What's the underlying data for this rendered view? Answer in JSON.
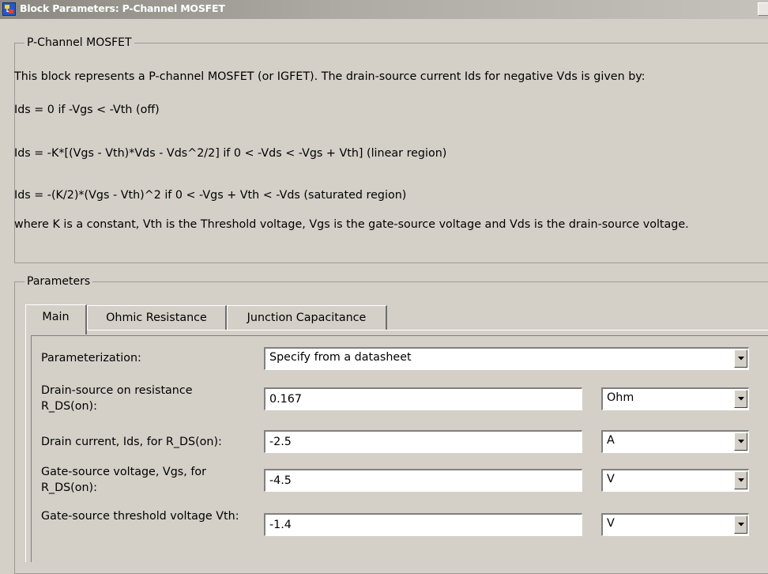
{
  "window": {
    "title": "Block Parameters: P-Channel MOSFET"
  },
  "description": {
    "legend": "P-Channel MOSFET",
    "lines": [
      "This block represents a P-channel MOSFET (or IGFET). The drain-source current Ids for negative Vds is given by:",
      "Ids = 0 if -Vgs < -Vth (off)",
      "Ids = -K*[(Vgs - Vth)*Vds - Vds^2/2] if 0 < -Vds < -Vgs + Vth] (linear region)",
      "Ids = -(K/2)*(Vgs - Vth)^2 if 0 < -Vgs + Vth < -Vds (saturated region)",
      "where K is a constant, Vth is the Threshold voltage, Vgs is the gate-source voltage and Vds is the drain-source voltage."
    ]
  },
  "parameters": {
    "legend": "Parameters",
    "tabs": [
      {
        "label": "Main",
        "active": true
      },
      {
        "label": "Ohmic Resistance",
        "active": false
      },
      {
        "label": "Junction Capacitance",
        "active": false
      }
    ],
    "parameterization": {
      "label": "Parameterization:",
      "value": "Specify from a datasheet"
    },
    "rows": [
      {
        "label": "Drain-source on resistance R_DS(on):",
        "value": "0.167",
        "unit": "Ohm"
      },
      {
        "label": "Drain current, Ids, for R_DS(on):",
        "value": "-2.5",
        "unit": "A"
      },
      {
        "label": "Gate-source voltage, Vgs, for R_DS(on):",
        "value": "-4.5",
        "unit": "V"
      },
      {
        "label": "Gate-source threshold voltage Vth:",
        "value": "-1.4",
        "unit": "V"
      }
    ]
  }
}
